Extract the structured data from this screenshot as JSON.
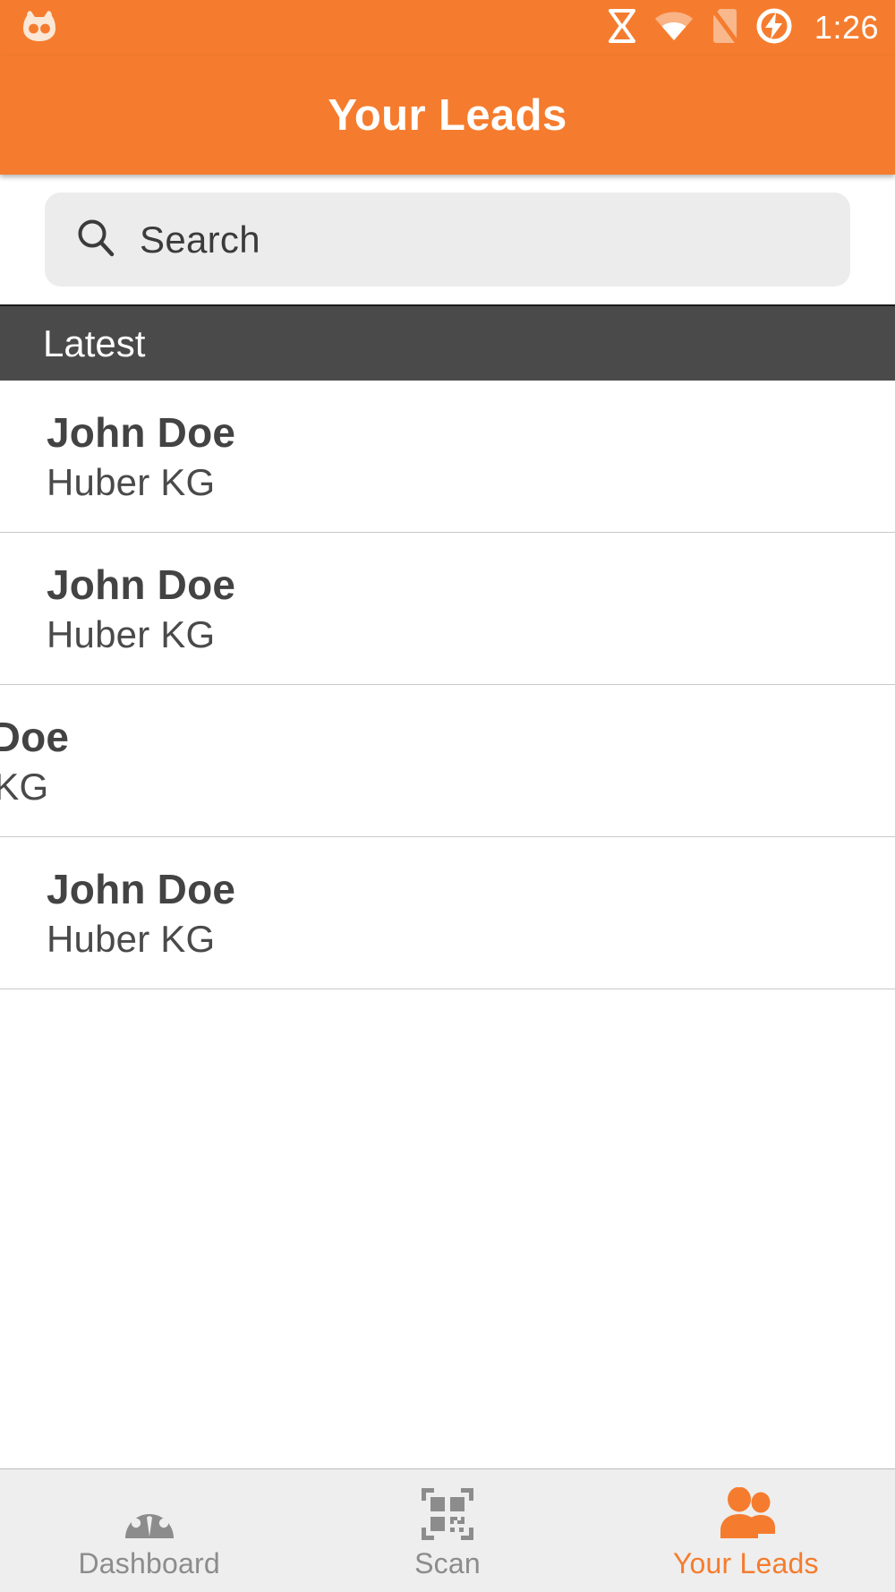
{
  "status_bar": {
    "time": "1:26",
    "logo_icon": "cyanogenmod-logo-icon",
    "icons": [
      "vpn-icon",
      "wifi-icon",
      "no-sim-card-icon",
      "battery-charging-icon"
    ]
  },
  "app_bar": {
    "title": "Your Leads"
  },
  "search": {
    "placeholder": "Search",
    "value": "",
    "icon": "search-icon"
  },
  "section": {
    "label": "Latest"
  },
  "list": {
    "rows": [
      {
        "name": "John Doe",
        "company": "Huber KG",
        "swiped": false
      },
      {
        "name": "John Doe",
        "company": "Huber KG",
        "swiped": false
      },
      {
        "name": "John Doe",
        "company": "Huber KG",
        "swiped": true,
        "delete_label": "",
        "delete_icon": "trash-icon"
      },
      {
        "name": "John Doe",
        "company": "Huber KG",
        "swiped": false
      }
    ]
  },
  "bottom_nav": {
    "items": [
      {
        "label": "Dashboard",
        "icon": "dashboard-gauge-icon",
        "active": false
      },
      {
        "label": "Scan",
        "icon": "qr-code-scan-icon",
        "active": false
      },
      {
        "label": "Your Leads",
        "icon": "people-group-icon",
        "active": true
      }
    ]
  },
  "colors": {
    "brand_orange": "#F57C2E",
    "section_dark": "#4a4a4a",
    "delete_red": "#E5413E",
    "nav_inactive": "#8c8c8c",
    "nav_bg": "#eeeeee",
    "search_bg": "#ececec"
  }
}
